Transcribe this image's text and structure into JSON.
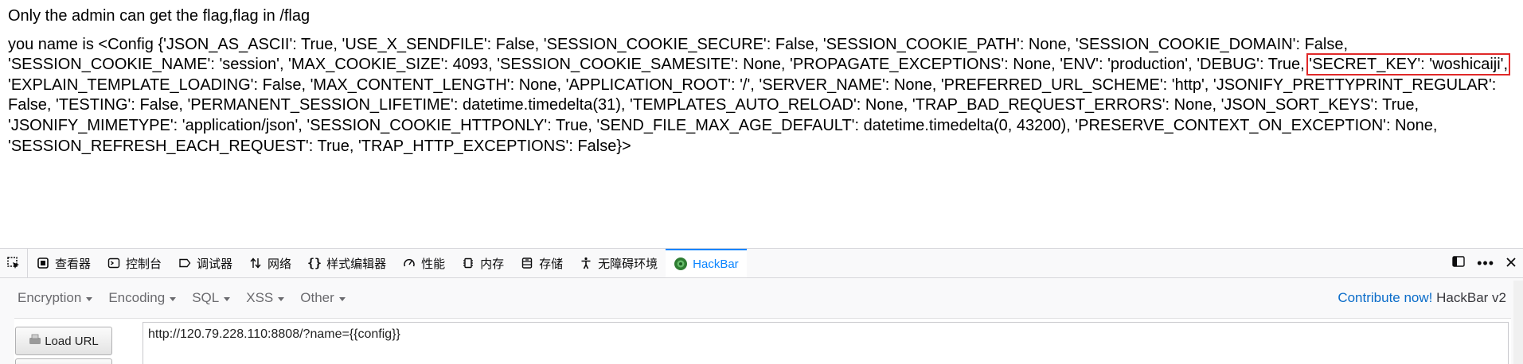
{
  "page": {
    "heading": "Only the admin can get the flag,flag in /flag",
    "config_before": "you name is <Config {'JSON_AS_ASCII': True, 'USE_X_SENDFILE': False, 'SESSION_COOKIE_SECURE': False, 'SESSION_COOKIE_PATH': None, 'SESSION_COOKIE_DOMAIN': False, 'SESSION_COOKIE_NAME': 'session', 'MAX_COOKIE_SIZE': 4093, 'SESSION_COOKIE_SAMESITE': None, 'PROPAGATE_EXCEPTIONS': None, 'ENV': 'production', 'DEBUG': True,",
    "config_secret": "'SECRET_KEY': 'woshicaiji',",
    "config_after": "'EXPLAIN_TEMPLATE_LOADING': False, 'MAX_CONTENT_LENGTH': None, 'APPLICATION_ROOT': '/', 'SERVER_NAME': None, 'PREFERRED_URL_SCHEME': 'http', 'JSONIFY_PRETTYPRINT_REGULAR': False, 'TESTING': False, 'PERMANENT_SESSION_LIFETIME': datetime.timedelta(31), 'TEMPLATES_AUTO_RELOAD': None, 'TRAP_BAD_REQUEST_ERRORS': None, 'JSON_SORT_KEYS': True, 'JSONIFY_MIMETYPE': 'application/json', 'SESSION_COOKIE_HTTPONLY': True, 'SEND_FILE_MAX_AGE_DEFAULT': datetime.timedelta(0, 43200), 'PRESERVE_CONTEXT_ON_EXCEPTION': None, 'SESSION_REFRESH_EACH_REQUEST': True, 'TRAP_HTTP_EXCEPTIONS': False}>"
  },
  "devtools": {
    "tabs": [
      {
        "label": "查看器",
        "icon": "inspector-icon"
      },
      {
        "label": "控制台",
        "icon": "console-icon"
      },
      {
        "label": "调试器",
        "icon": "debugger-icon"
      },
      {
        "label": "网络",
        "icon": "network-icon"
      },
      {
        "label": "样式编辑器",
        "icon": "style-editor-icon"
      },
      {
        "label": "性能",
        "icon": "performance-icon"
      },
      {
        "label": "内存",
        "icon": "memory-icon"
      },
      {
        "label": "存储",
        "icon": "storage-icon"
      },
      {
        "label": "无障碍环境",
        "icon": "accessibility-icon"
      },
      {
        "label": "HackBar",
        "icon": "hackbar-icon"
      }
    ],
    "active_tab": "HackBar"
  },
  "hackbar": {
    "menus": [
      "Encryption",
      "Encoding",
      "SQL",
      "XSS",
      "Other"
    ],
    "contribute_link": "Contribute now!",
    "brand": "HackBar v2",
    "load_url_label": "Load URL",
    "url_value": "http://120.79.228.110:8808/?name={{config}}"
  },
  "colors": {
    "highlight_border": "#e02828",
    "active_tab": "#0a84ff",
    "link": "#0a6cc9"
  }
}
